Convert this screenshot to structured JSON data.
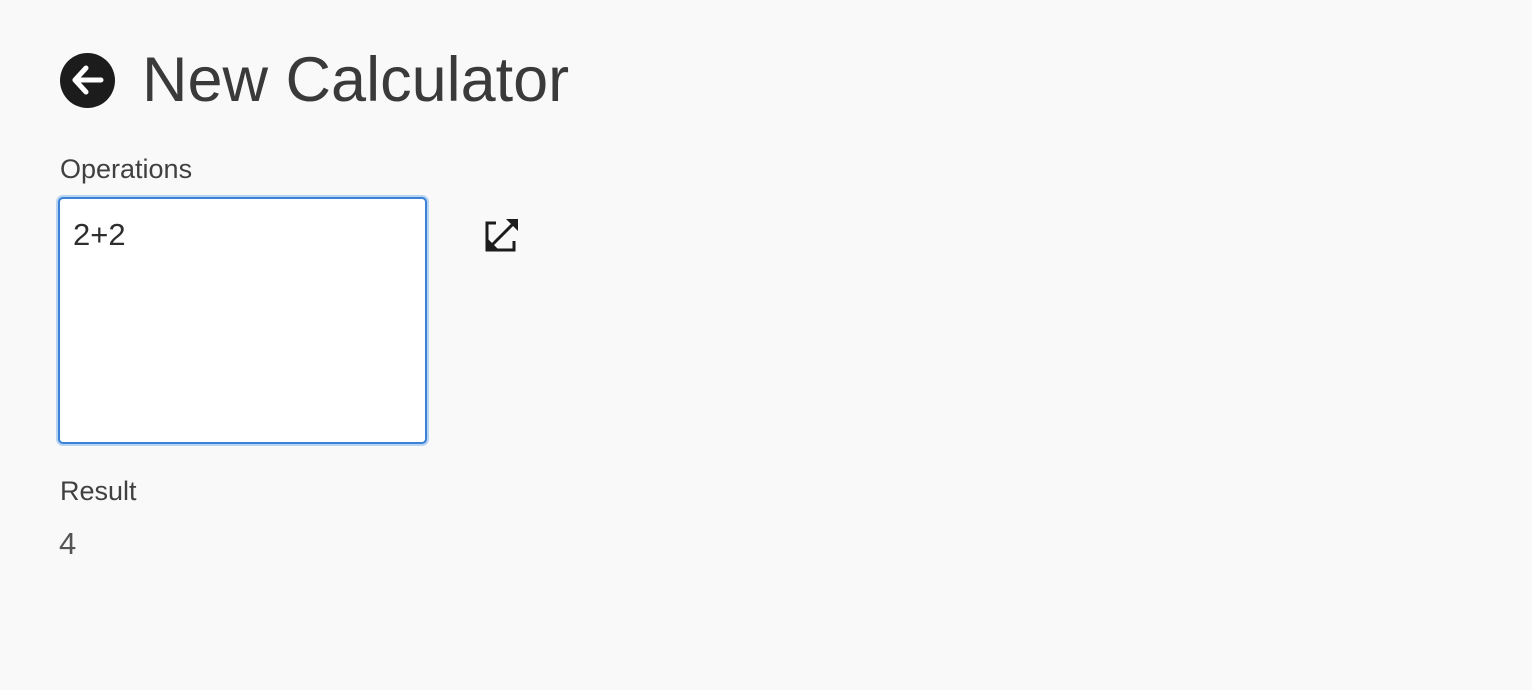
{
  "header": {
    "back_icon": "arrow-left-circle-icon",
    "title": "New Calculator"
  },
  "operations": {
    "label": "Operations",
    "value": "2+2"
  },
  "expand": {
    "icon": "expand-arrows-icon"
  },
  "result": {
    "label": "Result",
    "value": "4"
  },
  "colors": {
    "background": "#f9f9f9",
    "focus_border": "#3b82d6",
    "icon": "#1c1c1c"
  }
}
